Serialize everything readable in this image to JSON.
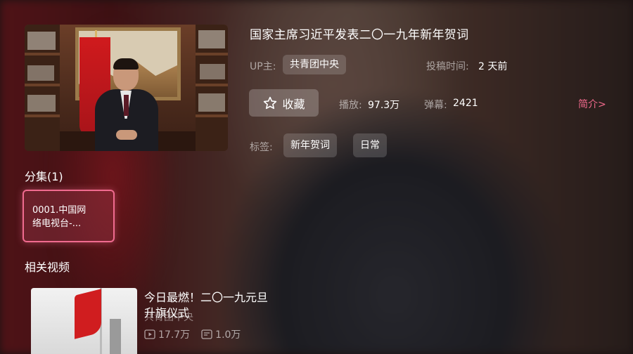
{
  "video": {
    "title": "国家主席习近平发表二〇一九年新年贺词",
    "uploader_label": "UP主:",
    "uploader": "共青团中央",
    "posted_label": "投稿时间:",
    "posted": "2 天前",
    "favorite_label": "收藏",
    "plays_label": "播放:",
    "plays": "97.3万",
    "danmaku_label": "弹幕:",
    "danmaku": "2421",
    "intro_link": "简介>",
    "tags_label": "标签:",
    "tags": [
      "新年贺词",
      "日常"
    ]
  },
  "episodes": {
    "heading": "分集(1)",
    "items": [
      {
        "line1": "0001.中国网",
        "line2": "络电视台-..."
      }
    ]
  },
  "related": {
    "heading": "相关视频",
    "items": [
      {
        "title_line1": "今日最燃！二〇一九元旦",
        "title_line2": "升旗仪式",
        "uploader": "共青团中央",
        "plays": "17.7万",
        "danmaku": "1.0万"
      }
    ]
  },
  "colors": {
    "accent": "#f26a8d",
    "focus_border": "#f06b8f"
  }
}
